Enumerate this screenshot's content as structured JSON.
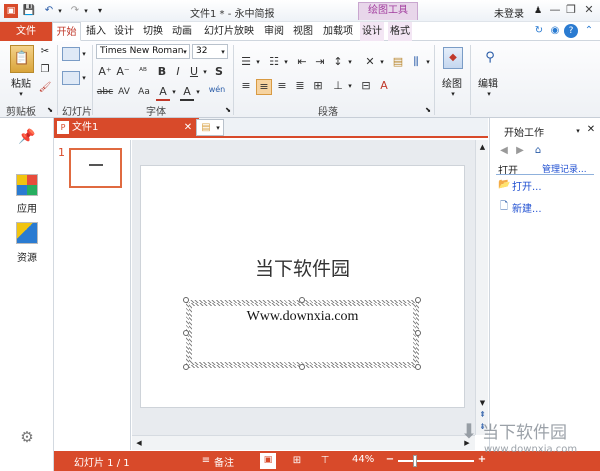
{
  "window": {
    "title": "文件1 * - 永中简报",
    "contextual_tab_group": "绘图工具",
    "user": "未登录",
    "controls": {
      "minimize": "—",
      "restore": "❐",
      "close": "✕"
    }
  },
  "tabs": [
    "文件",
    "开始",
    "插入",
    "设计",
    "切换",
    "动画",
    "幻灯片放映",
    "审阅",
    "视图",
    "加载项",
    "设计",
    "格式"
  ],
  "ribbon": {
    "groups": {
      "clipboard": "剪贴板",
      "slides": "幻灯片",
      "font": "字体",
      "paragraph": "段落"
    },
    "paste_label": "粘贴",
    "font_name": "Times New Roman",
    "font_size": "32",
    "drawing_label": "绘图",
    "editing_label": "编辑"
  },
  "left_rail": {
    "apps_label": "应用",
    "resources_label": "资源"
  },
  "document": {
    "tab_label": "文件1",
    "thumbnail_number": "1",
    "slide_title": "当下软件园",
    "slide_body": "Www.downxia.com"
  },
  "task_pane": {
    "title": "开始工作",
    "open_section": "打开",
    "manage_link": "管理记录...",
    "open_link": "打开...",
    "new_link": "新建..."
  },
  "status": {
    "slide_info": "幻灯片 1 / 1",
    "notes": "备注",
    "zoom": "44%",
    "zoom_level": 0.44
  },
  "watermark": {
    "text": "当下软件园",
    "url": "www.downxia.com"
  },
  "colors": {
    "accent": "#d84a2a",
    "contextual": "#a23d9e",
    "link": "#1f4fd1"
  }
}
